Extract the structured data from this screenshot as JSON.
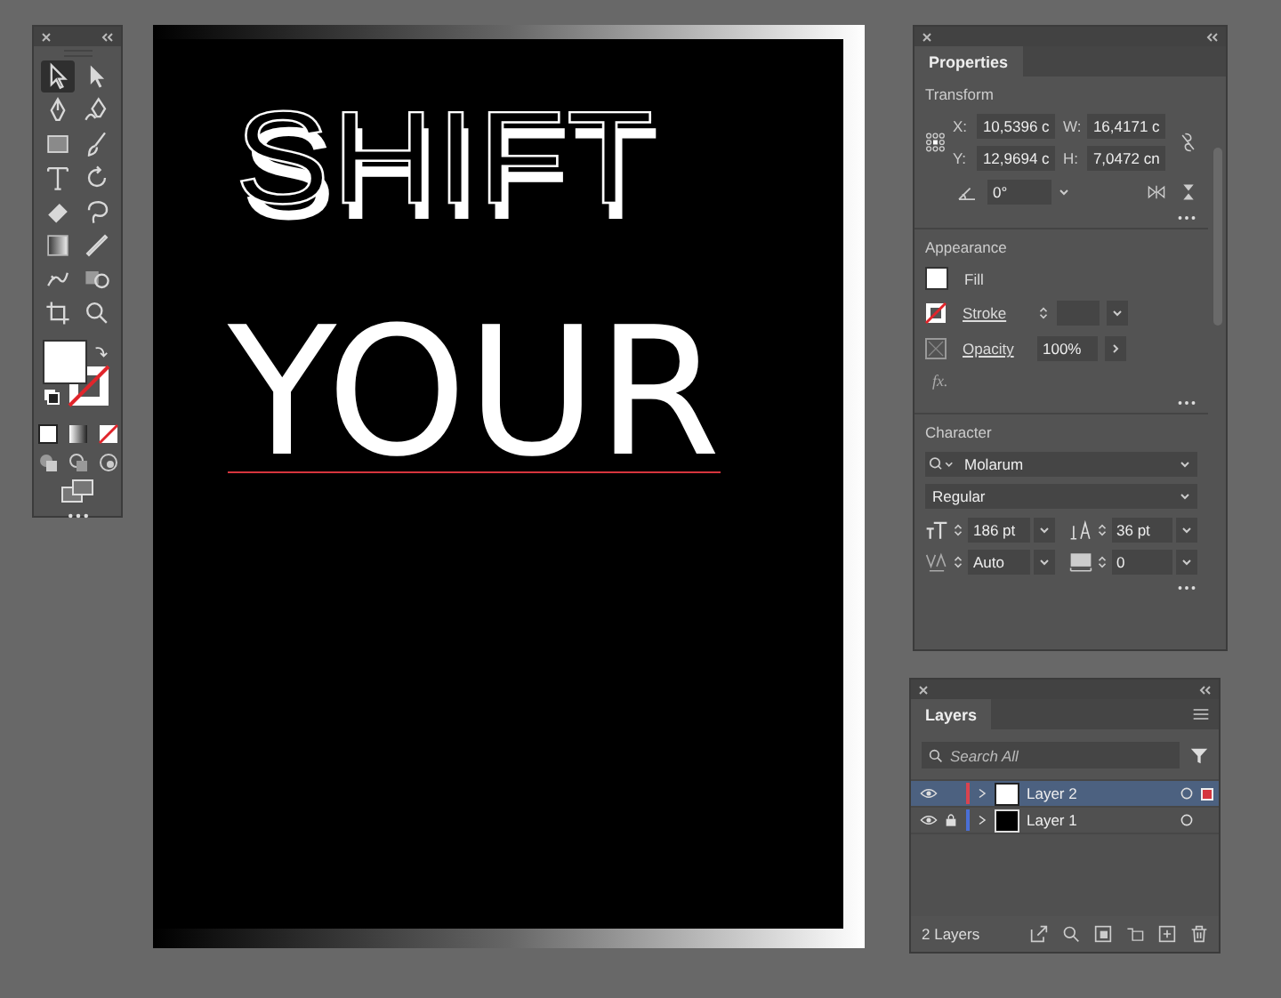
{
  "tools": [
    {
      "kind": "selection",
      "selected": true
    },
    {
      "kind": "direct",
      "selected": false
    },
    {
      "kind": "pen",
      "selected": false
    },
    {
      "kind": "curvature",
      "selected": false
    },
    {
      "kind": "rectangle",
      "selected": false
    },
    {
      "kind": "brush",
      "selected": false
    },
    {
      "kind": "type",
      "selected": false
    },
    {
      "kind": "rotate",
      "selected": false
    },
    {
      "kind": "eraser",
      "selected": false
    },
    {
      "kind": "lasso",
      "selected": false
    },
    {
      "kind": "gradient",
      "selected": false
    },
    {
      "kind": "eyedropper",
      "selected": false
    },
    {
      "kind": "warp",
      "selected": false
    },
    {
      "kind": "builder",
      "selected": false
    },
    {
      "kind": "artboard",
      "selected": false
    },
    {
      "kind": "zoom",
      "selected": false
    }
  ],
  "artboard": {
    "lines": [
      {
        "text": "SHIFT",
        "kind": "outlined",
        "selected": false
      },
      {
        "text": "YOUR",
        "kind": "solid",
        "selected": true
      }
    ]
  },
  "properties": {
    "tab": "Properties",
    "transform": {
      "title": "Transform",
      "x_label": "X:",
      "x": "10,5396 c",
      "w_label": "W:",
      "w": "16,4171 c",
      "y_label": "Y:",
      "y": "12,9694 c",
      "h_label": "H:",
      "h": "7,0472 cn",
      "angle": "0°"
    },
    "appearance": {
      "title": "Appearance",
      "fill": "Fill",
      "stroke": "Stroke",
      "opacity_label": "Opacity",
      "opacity": "100%",
      "fx": "fx."
    },
    "character": {
      "title": "Character",
      "font": "Molarum",
      "style": "Regular",
      "size": "186 pt",
      "leading": "36 pt",
      "kerning": "Auto",
      "tracking": "0"
    }
  },
  "layers": {
    "tab": "Layers",
    "search_placeholder": "Search All",
    "items": [
      {
        "name": "Layer 2",
        "color": "#d9434f",
        "locked": false,
        "selected": true,
        "kind": "light"
      },
      {
        "name": "Layer 1",
        "color": "#4a6fd6",
        "locked": true,
        "selected": false,
        "kind": "dark"
      }
    ],
    "footer": "2 Layers"
  }
}
